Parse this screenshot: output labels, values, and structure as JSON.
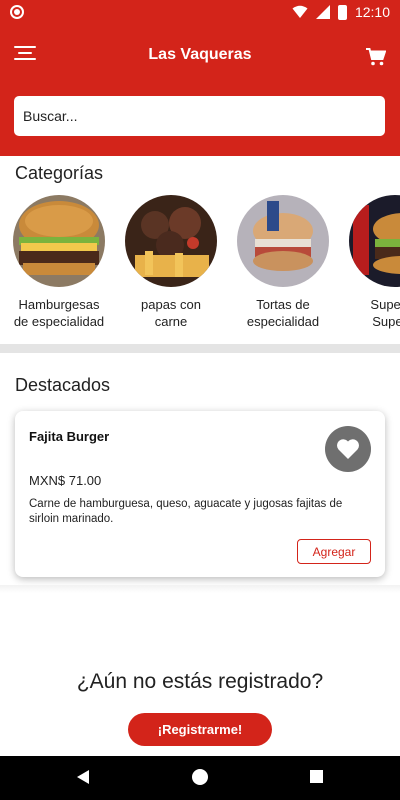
{
  "status_bar": {
    "time": "12:10"
  },
  "app_bar": {
    "title": "Las Vaqueras",
    "search_placeholder": "Buscar..."
  },
  "categories": {
    "heading": "Categorías",
    "items": [
      {
        "label_line1": "Hamburgesas",
        "label_line2": "de especialidad"
      },
      {
        "label_line1": "papas con",
        "label_line2": "carne"
      },
      {
        "label_line1": "Tortas de",
        "label_line2": "especialidad"
      },
      {
        "label_line1": "Superbu",
        "label_line2": "Superto"
      }
    ]
  },
  "featured": {
    "heading": "Destacados",
    "product": {
      "name": "Fajita Burger",
      "price": "MXN$ 71.00",
      "description": "Carne de hamburguesa, queso, aguacate y jugosas fajitas de sirloin marinado.",
      "add_label": "Agregar"
    }
  },
  "register": {
    "question": "¿Aún no estás registrado?",
    "button_label": "¡Registrarme!"
  },
  "colors": {
    "primary": "#d3241a",
    "favorite_bg": "#6f6f6f"
  }
}
